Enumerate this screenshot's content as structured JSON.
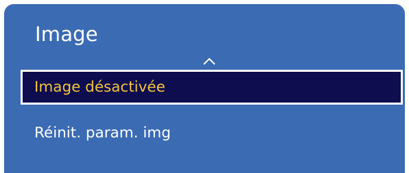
{
  "menu": {
    "title": "Image",
    "up_icon": "chevron-up-icon",
    "items": [
      {
        "label": "Image désactivée",
        "selected": true
      },
      {
        "label": "Réinit. param. img",
        "selected": false
      }
    ]
  },
  "colors": {
    "panel_background": "#3b6bb3",
    "selected_background": "#0d0d4f",
    "selected_text": "#f5c33b",
    "text": "#ffffff"
  }
}
